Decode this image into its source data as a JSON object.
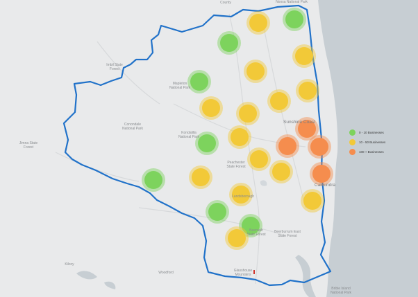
{
  "colors": {
    "low": "#7dd35d",
    "mid": "#f2c938",
    "high": "#f58d4e",
    "boundary": "#2172c9",
    "land": "#e9eaeb",
    "sea": "#c7ced3"
  },
  "legend": [
    {
      "label": "0 - 10 Businesses",
      "category": "low"
    },
    {
      "label": "10 - 50 Businesses",
      "category": "mid"
    },
    {
      "label": "100 + Businesses",
      "category": "high"
    }
  ],
  "places": [
    {
      "name": "Sunshine Coast",
      "key": "sunshine-coast"
    },
    {
      "name": "Caloundra",
      "key": "caloundra"
    },
    {
      "name": "Peachester\nState Forest\n",
      "key": "peachester"
    },
    {
      "name": "Mapleton\nNational Park",
      "key": "mapleton-np"
    },
    {
      "name": "Kondalilla\nNational Park",
      "key": "kondalilla-np"
    },
    {
      "name": "Conondale\nNational Park",
      "key": "conondale-np"
    },
    {
      "name": "Imbil State\nForest",
      "key": "imbil-sf"
    },
    {
      "name": "Jimna State\nForest",
      "key": "jimna-sf"
    },
    {
      "name": "Beerburrum East\nState Forest",
      "key": "beerburrum-east"
    },
    {
      "name": "Beerwah\nState Forest",
      "key": "beerwah-sf"
    },
    {
      "name": "Woodford",
      "key": "woodford"
    },
    {
      "name": "Kilcoy",
      "key": "kilcoy"
    },
    {
      "name": "Bribie Island\nNational Park",
      "key": "bribie-np"
    },
    {
      "name": "Glasshouse\nMountains",
      "key": "glasshouse"
    },
    {
      "name": "County",
      "key": "county"
    },
    {
      "name": "Noosa National Park",
      "key": "noosa-np"
    },
    {
      "name": "Landsborough",
      "key": "landsborough"
    }
  ],
  "clusters": [
    {
      "category": "low"
    },
    {
      "category": "mid"
    },
    {
      "category": "low"
    },
    {
      "category": "mid"
    },
    {
      "category": "mid"
    },
    {
      "category": "low"
    },
    {
      "category": "mid"
    },
    {
      "category": "mid"
    },
    {
      "category": "mid"
    },
    {
      "category": "mid"
    },
    {
      "category": "high"
    },
    {
      "category": "low"
    },
    {
      "category": "mid"
    },
    {
      "category": "high"
    },
    {
      "category": "high"
    },
    {
      "category": "mid"
    },
    {
      "category": "mid"
    },
    {
      "category": "low"
    },
    {
      "category": "mid"
    },
    {
      "category": "high"
    },
    {
      "category": "mid"
    },
    {
      "category": "mid"
    },
    {
      "category": "low"
    },
    {
      "category": "low"
    },
    {
      "category": "mid"
    }
  ]
}
